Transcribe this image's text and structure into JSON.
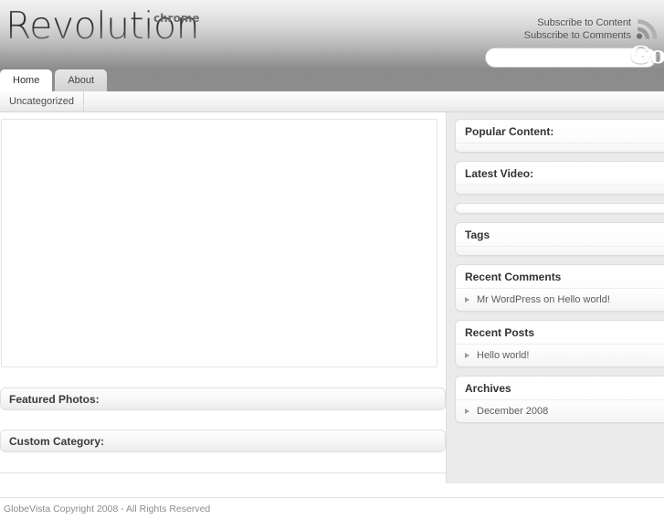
{
  "header": {
    "logo_main": "Revolution",
    "logo_sub": "chrome",
    "subscribe_content": "Subscribe to Content",
    "subscribe_comments": "Subscribe to Comments",
    "rss_icon": "rss-icon",
    "search": {
      "value": "",
      "placeholder": "",
      "go_label": "Go"
    }
  },
  "nav": {
    "tabs": [
      {
        "label": "Home",
        "active": true
      },
      {
        "label": "About",
        "active": false
      }
    ],
    "subnav": [
      {
        "label": "Uncategorized"
      }
    ]
  },
  "main": {
    "post_area_text": "",
    "sections": [
      {
        "label": "Featured Photos:"
      },
      {
        "label": "Custom Category:"
      }
    ]
  },
  "sidebar": {
    "widgets": [
      {
        "title": "Popular Content:",
        "items": []
      },
      {
        "title": "Latest Video:",
        "items": []
      },
      {
        "title": "",
        "items": [],
        "empty": true
      },
      {
        "title": "Tags",
        "items": []
      },
      {
        "title": "Recent Comments",
        "items": [
          "Mr WordPress on Hello world!"
        ]
      },
      {
        "title": "Recent Posts",
        "items": [
          "Hello world!"
        ]
      },
      {
        "title": "Archives",
        "items": [
          "December 2008"
        ]
      }
    ]
  },
  "footer": {
    "copyright": "GlobeVista Copyright 2008 - All Rights Reserved"
  },
  "colors": {
    "header_top": "#f2f2f2",
    "header_bottom": "#8b8b8b",
    "sidebar_bg": "#ebebeb",
    "text_dark": "#333333",
    "text_muted": "#8c8c8c",
    "bullet": "#9a9a9a"
  }
}
